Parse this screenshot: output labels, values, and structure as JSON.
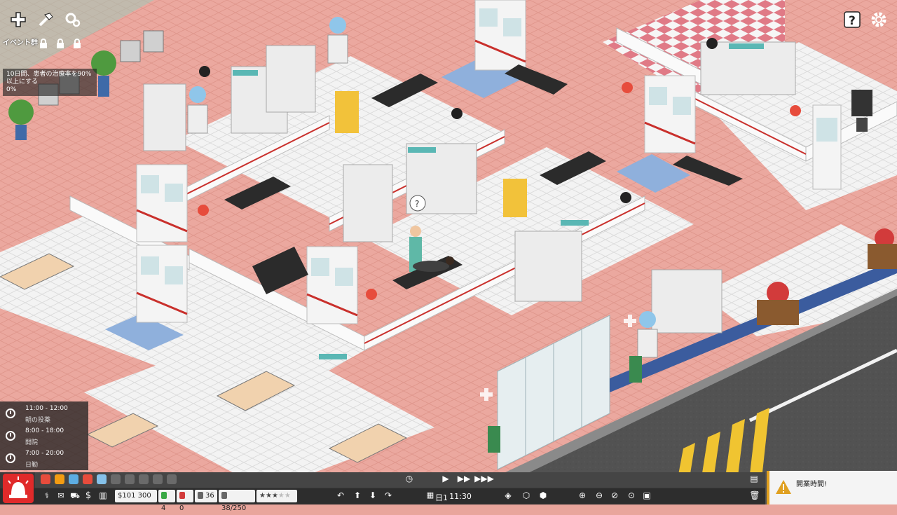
{
  "hud": {
    "event_label": "イベント群",
    "goal_line1": "10日間、患者の治療率を90%",
    "goal_line2": "以上にする",
    "goal_progress": "0%",
    "icons": [
      "plus-icon",
      "hammer-icon",
      "gears-icon",
      "help-icon",
      "settings-icon"
    ]
  },
  "schedule": [
    {
      "time": "11:00 - 12:00",
      "name": "朝の投薬"
    },
    {
      "time": "8:00 - 18:00",
      "name": "開院"
    },
    {
      "time": "7:00 - 20:00",
      "name": "日勤"
    }
  ],
  "status": {
    "money": "$101 300",
    "staff": "4",
    "patients_waiting": "0",
    "patients_total": "36",
    "capacity": "38/250",
    "rating_stars": 3,
    "day_label": "日1",
    "clock": "11:30"
  },
  "notification": {
    "text": "開業時間!"
  },
  "colors": {
    "floor_pink": "#e9a59c",
    "floor_white": "#f2f2f2",
    "road": "#4f4f4f",
    "wall_red": "#c9302c",
    "hud_dark": "#2d2d2d",
    "alarm_red": "#e02a2a",
    "warning_yellow": "#e0a020"
  }
}
